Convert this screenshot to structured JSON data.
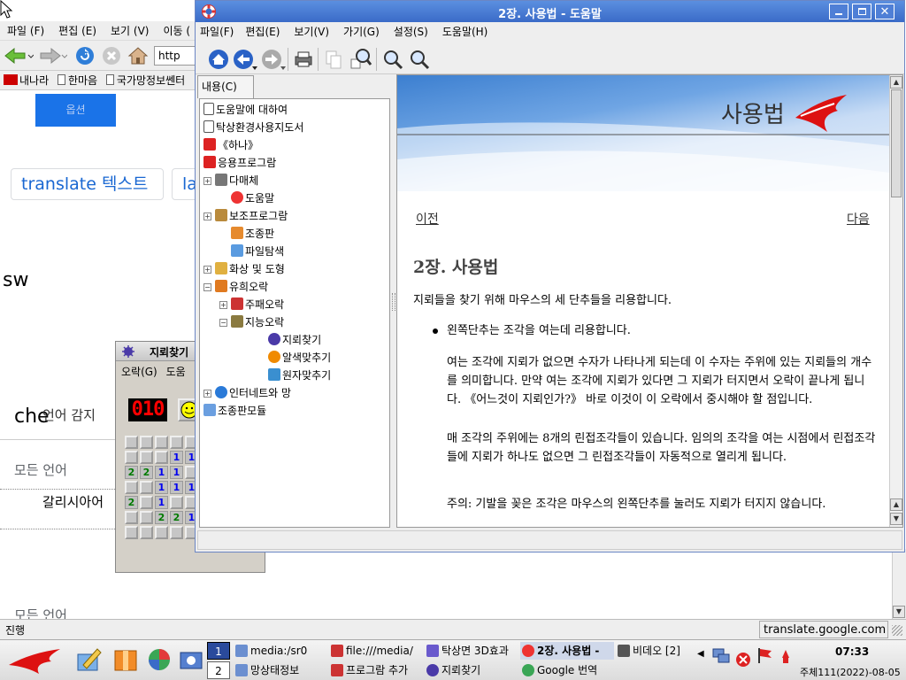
{
  "browser": {
    "menu": [
      "파일 (F)",
      "편집 (E)",
      "보기 (V)",
      "이동 ("
    ],
    "url_prefix": "http",
    "bookmarks": [
      "내나라",
      "한마음",
      "국가망정보쎈터"
    ],
    "blue_button": "옵션",
    "chips": [
      "translate 텍스트",
      "la"
    ],
    "side_text": "sw",
    "lang_text": "che",
    "lang_detect": "언어 감지",
    "all_languages": "모든 언어",
    "galician": "갈리시아어",
    "all_languages_2": "모든 언어",
    "status_left": "진행",
    "status_right": "translate.google.com"
  },
  "minesweeper": {
    "title": "지뢰찾기",
    "menu": [
      "오락(G)",
      "도움"
    ],
    "counter": "010",
    "grid": [
      [
        "",
        "",
        "",
        "",
        "",
        ""
      ],
      [
        "",
        "",
        "",
        "1",
        "1",
        ""
      ],
      [
        "2",
        "2",
        "1",
        "1",
        "",
        ""
      ],
      [
        "",
        "",
        "1",
        "1",
        "1",
        ""
      ],
      [
        "2",
        "",
        "1",
        "",
        "",
        ""
      ],
      [
        "",
        "",
        "2",
        "2",
        "1",
        ""
      ],
      [
        "",
        "",
        "",
        "",
        "",
        ""
      ]
    ]
  },
  "help": {
    "title": "2장. 사용법 - 도움말",
    "menu": [
      "파일(F)",
      "편집(E)",
      "보기(V)",
      "가기(G)",
      "설정(S)",
      "도움말(H)"
    ],
    "tab": "내용(C)",
    "tree": [
      {
        "label": "도움말에 대하여",
        "indent": 0,
        "exp": "",
        "icon": "page-icon"
      },
      {
        "label": "탁상환경사용지도서",
        "indent": 0,
        "exp": "",
        "icon": "page-icon"
      },
      {
        "label": "《하나》",
        "indent": 0,
        "exp": "",
        "icon": "rocket-icon"
      },
      {
        "label": "응용프로그람",
        "indent": 0,
        "exp": "",
        "icon": "bird-icon"
      },
      {
        "label": "다매체",
        "indent": 0,
        "exp": "+",
        "icon": "media-icon"
      },
      {
        "label": "도움말",
        "indent": 1,
        "exp": "",
        "icon": "lifebuoy-icon"
      },
      {
        "label": "보조프로그람",
        "indent": 0,
        "exp": "+",
        "icon": "tools-icon"
      },
      {
        "label": "조종판",
        "indent": 1,
        "exp": "",
        "icon": "control-icon"
      },
      {
        "label": "파일탐색",
        "indent": 1,
        "exp": "",
        "icon": "file-search-icon"
      },
      {
        "label": "화상 및 도형",
        "indent": 0,
        "exp": "+",
        "icon": "image-icon"
      },
      {
        "label": "유희오락",
        "indent": 0,
        "exp": "-",
        "icon": "game-icon"
      },
      {
        "label": "주패오락",
        "indent": 1,
        "exp": "+",
        "icon": "cards-icon"
      },
      {
        "label": "지능오락",
        "indent": 1,
        "exp": "-",
        "icon": "puzzle-icon"
      },
      {
        "label": "지뢰찾기",
        "indent": 3,
        "exp": "",
        "icon": "mine-icon"
      },
      {
        "label": "알색맞추기",
        "indent": 3,
        "exp": "",
        "icon": "ball-icon"
      },
      {
        "label": "원자맞추기",
        "indent": 3,
        "exp": "",
        "icon": "atom-icon"
      },
      {
        "label": "인터네트와 망",
        "indent": 0,
        "exp": "+",
        "icon": "globe-icon"
      },
      {
        "label": "조종판모듈",
        "indent": 0,
        "exp": "",
        "icon": "module-icon"
      }
    ],
    "banner_title": "사용법",
    "prev": "이전",
    "next": "다음",
    "heading": "2장. 사용법",
    "intro": "지뢰들을 찾기 위해 마우스의 세 단추들을 리용합니다.",
    "bullet1": "왼쪽단추는 조각을 여는데 리용합니다.",
    "para1": "여는 조각에 지뢰가 없으면 수자가 나타나게 되는데 이 수자는 주위에 있는 지뢰들의 개수를 의미합니다. 만약 여는 조각에 지뢰가 있다면 그 지뢰가 터지면서 오락이 끝나게 됩니다. 《어느것이 지뢰인가?》 바로 이것이 이 오락에서 중시해야 할 점입니다.",
    "para2": "매 조각의 주위에는 8개의 린접조각들이 있습니다. 임의의 조각을 여는 시점에서 린접조각들에 지뢰가 하나도 없으면 그 린접조각들이 자동적으로 열리게 됩니다.",
    "para3": "주의: 기발을 꽂은 조각은 마우스의 왼쪽단추를 눌러도 지뢰가 터지지 않습니다."
  },
  "taskbar": {
    "pager": [
      "1",
      "2"
    ],
    "tasks_top": [
      "media:/sr0",
      "file:///media/",
      "탁상면 3D효과",
      "2장. 사용법 -",
      "비데오 [2]"
    ],
    "tasks_bottom": [
      "망상태정보",
      "프로그람 추가",
      "지뢰찾기",
      "Google 번역"
    ],
    "clock": "07:33",
    "date": "주체111(2022)-08-05"
  }
}
